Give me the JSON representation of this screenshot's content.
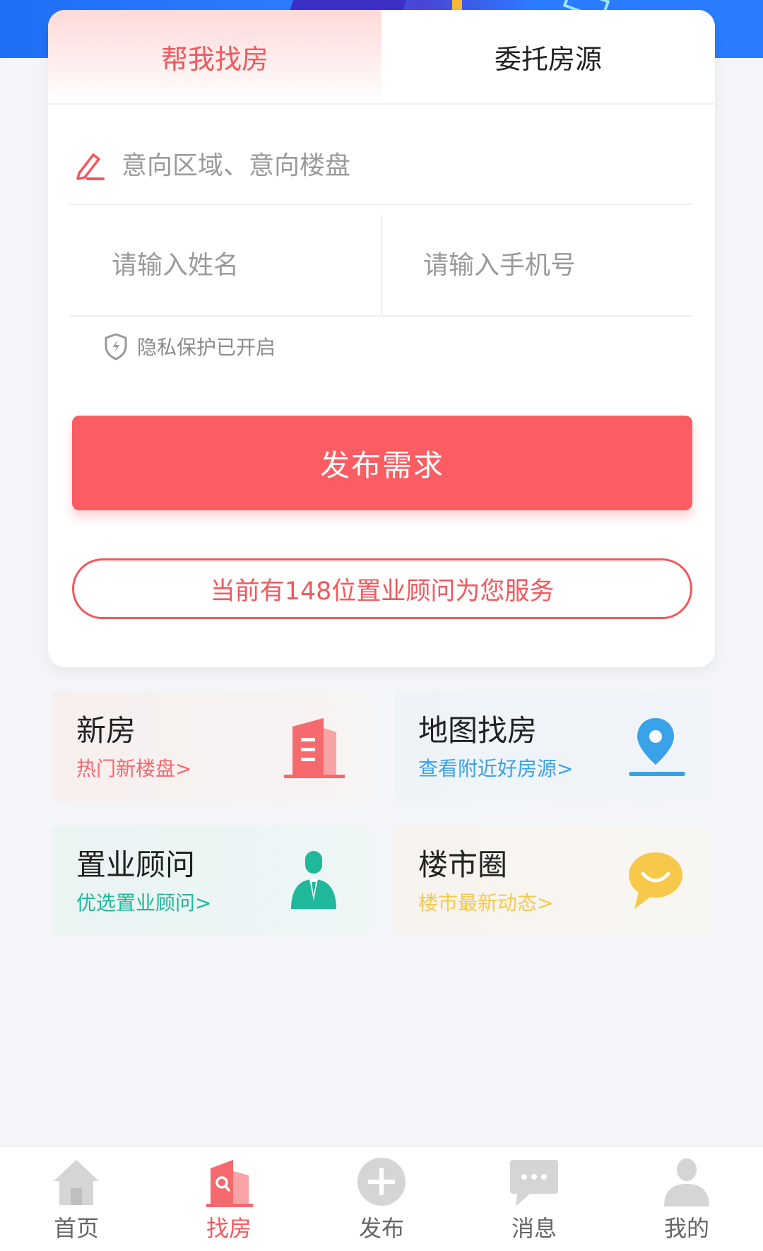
{
  "tabs": [
    {
      "label": "帮我找房"
    },
    {
      "label": "委托房源"
    }
  ],
  "form": {
    "region_placeholder": "意向区域、意向楼盘",
    "name_placeholder": "请输入姓名",
    "phone_placeholder": "请输入手机号",
    "privacy_text": "隐私保护已开启",
    "submit_label": "发布需求",
    "advisor_text": "当前有148位置业顾问为您服务"
  },
  "grid": [
    {
      "title": "新房",
      "sub": "热门新楼盘>",
      "icon": "building-icon"
    },
    {
      "title": "地图找房",
      "sub": "查看附近好房源>",
      "icon": "map-pin-icon"
    },
    {
      "title": "置业顾问",
      "sub": "优选置业顾问>",
      "icon": "advisor-icon"
    },
    {
      "title": "楼市圈",
      "sub": "楼市最新动态>",
      "icon": "chat-bubble-icon"
    }
  ],
  "tabbar": {
    "active_index": 1,
    "items": [
      {
        "label": "首页",
        "icon": "home-icon"
      },
      {
        "label": "找房",
        "icon": "find-house-icon"
      },
      {
        "label": "发布",
        "icon": "plus-circle-icon"
      },
      {
        "label": "消息",
        "icon": "message-icon"
      },
      {
        "label": "我的",
        "icon": "user-icon"
      }
    ]
  },
  "colors": {
    "accent": "#f4585d",
    "button": "#fb5d63",
    "map_blue": "#3aa2e8",
    "advisor_green": "#1fb89a",
    "market_yellow": "#f7c84a",
    "banner_blue": "#2b7cff"
  }
}
